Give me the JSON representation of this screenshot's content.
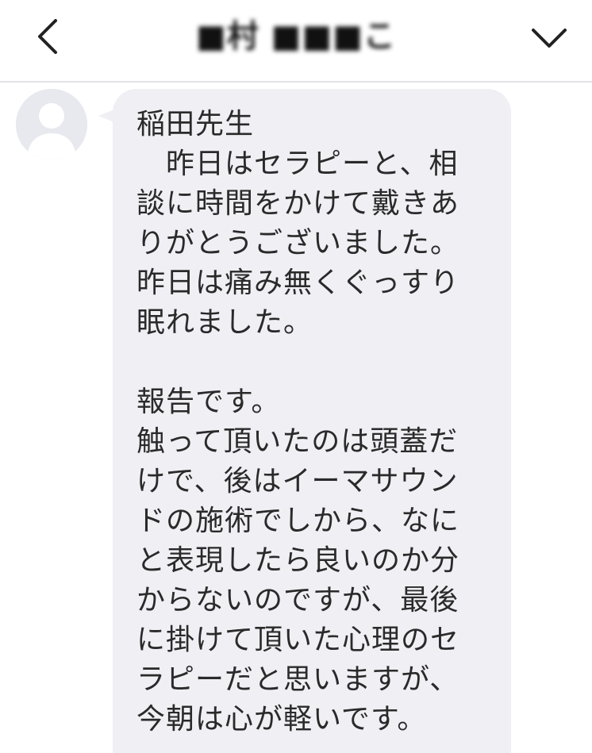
{
  "header": {
    "contact_name": "■村 ■■■こ",
    "back_icon": "chevron-left-icon",
    "menu_icon": "chevron-down-icon"
  },
  "conversation": {
    "messages": [
      {
        "sender": "incoming",
        "avatar_icon": "default-user-avatar-icon",
        "text": "稲田先生\n　昨日はセラピーと、相\n談に時間をかけて戴きあ\nりがとうございました。\n昨日は痛み無くぐっすり\n眠れました。\n\n報告です。\n触って頂いたのは頭蓋だ\nけで、後はイーマサウン\nドの施術でしから、なに\nと表現したら良いのか分\nからないのですが、最後\nに掛けて頂いた心理のセ\nラピーだと思いますが、\n今朝は心が軽いです。"
      }
    ]
  },
  "colors": {
    "bubble_background": "#efeff4",
    "avatar_background": "#e8e9ee",
    "avatar_silhouette": "#ffffff",
    "header_divider": "#e3e3e6",
    "text": "#2a2a2a"
  }
}
